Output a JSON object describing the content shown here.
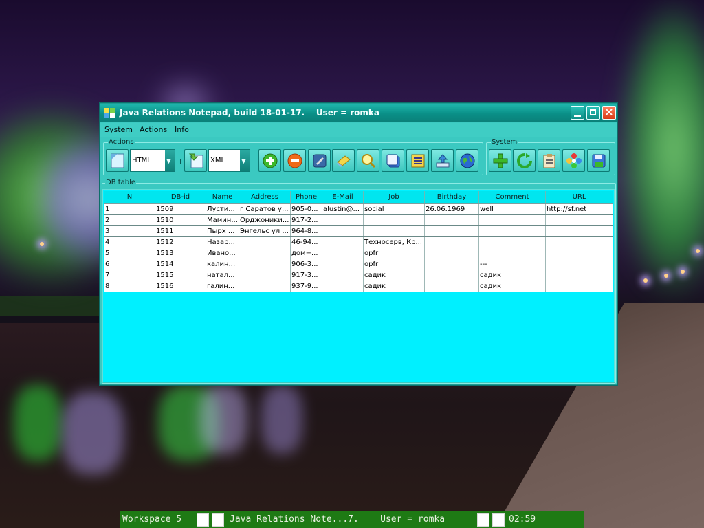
{
  "window": {
    "title": "Java Relations Notepad, build 18-01-17.    User = romka"
  },
  "menu": [
    "System",
    "Actions",
    "Info"
  ],
  "groups": {
    "actions_label": "Actions",
    "system_label": "System",
    "table_label": "DB table"
  },
  "toolbar": {
    "export_format": "HTML",
    "import_format": "XML",
    "action_icons": [
      "export-page-icon",
      "import-page-icon",
      "add-icon",
      "remove-icon",
      "settings-icon",
      "clean-icon",
      "search-icon",
      "copy-icon",
      "list-icon",
      "upload-icon",
      "globe-icon"
    ],
    "system_icons": [
      "plus-icon",
      "refresh-icon",
      "clipboard-icon",
      "flower-icon",
      "save-icon"
    ]
  },
  "table": {
    "columns": [
      "N",
      "DB-id",
      "Name",
      "Address",
      "Phone",
      "E-Mail",
      "Job",
      "Birthday",
      "Comment",
      "URL"
    ],
    "rows": [
      [
        "1",
        "1509",
        "Лусти...",
        "г Саратов у...",
        "905-0...",
        "alustin@...",
        "social",
        "26.06.1969",
        "well",
        "http://sf.net"
      ],
      [
        "2",
        "1510",
        "Мамин...",
        "Орджоники...",
        "917-2...",
        "",
        "",
        "",
        "",
        ""
      ],
      [
        "3",
        "1511",
        "Пырх ...",
        "Энгельс ул ...",
        "964-8...",
        "",
        "",
        "",
        "",
        ""
      ],
      [
        "4",
        "1512",
        "Назар...",
        "",
        "46-94...",
        "",
        "Техносерв, Кр...",
        "",
        "",
        ""
      ],
      [
        "5",
        "1513",
        "Ивано...",
        "",
        "дом=...",
        "",
        "opfr",
        "",
        "",
        ""
      ],
      [
        "6",
        "1514",
        "калин...",
        "",
        "906-3...",
        "",
        "opfr",
        "",
        "---",
        ""
      ],
      [
        "7",
        "1515",
        "натал...",
        "",
        "917-3...",
        "",
        "садик",
        "",
        "садик",
        ""
      ],
      [
        "8",
        "1516",
        "галин...",
        "",
        "937-9...",
        "",
        "садик",
        "",
        "садик",
        ""
      ]
    ]
  },
  "taskbar": {
    "workspace": "Workspace 5",
    "task": "Java Relations Note...7.    User = romka",
    "clock": "02:59"
  },
  "colors": {
    "titlebar": "#0a8f87",
    "window": "#3bc9c1",
    "table_bg": "#00f0ff",
    "taskbar": "#1e7a14"
  }
}
